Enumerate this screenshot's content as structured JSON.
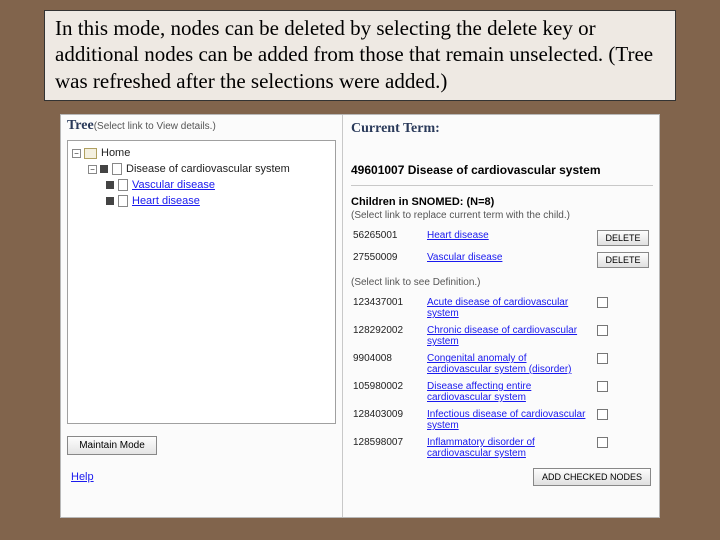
{
  "caption": "In this mode, nodes can be deleted by selecting the delete key or additional nodes can be added from those that remain unselected.  (Tree was refreshed after the selections were added.)",
  "left": {
    "heading": "Tree",
    "heading_hint": "(Select link to View details.)",
    "root": "Home",
    "child1": "Disease of cardiovascular system",
    "gc1": "Vascular disease",
    "gc2": "Heart disease",
    "maintain_btn": "Maintain Mode",
    "help": "Help"
  },
  "right": {
    "heading": "Current Term:",
    "term": "49601007 Disease of cardiovascular system",
    "children_heading": "Children in SNOMED: (N=8)",
    "hint_selected": "(Select link to replace current term with the child.)",
    "hint_unselected": "(Select link to see Definition.)",
    "delete_label": "DELETE",
    "add_label": "ADD CHECKED NODES",
    "selected": [
      {
        "code": "56265001",
        "name": "Heart disease"
      },
      {
        "code": "27550009",
        "name": "Vascular disease"
      }
    ],
    "unselected": [
      {
        "code": "123437001",
        "name": "Acute disease of cardiovascular system"
      },
      {
        "code": "128292002",
        "name": "Chronic disease of cardiovascular system"
      },
      {
        "code": "9904008",
        "name": "Congenital anomaly of cardiovascular system (disorder)"
      },
      {
        "code": "105980002",
        "name": "Disease affecting entire cardiovascular system"
      },
      {
        "code": "128403009",
        "name": "Infectious disease of cardiovascular system"
      },
      {
        "code": "128598007",
        "name": "Inflammatory disorder of cardiovascular system"
      }
    ]
  }
}
